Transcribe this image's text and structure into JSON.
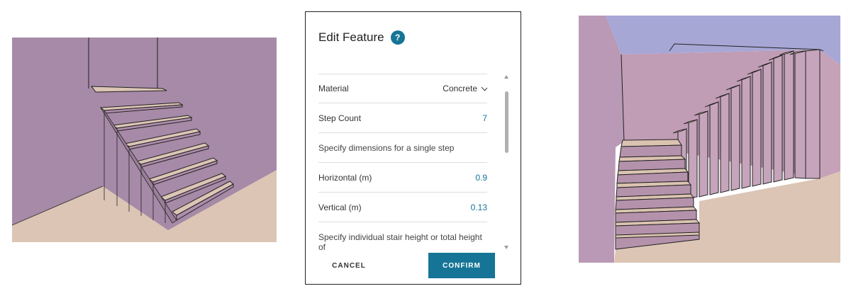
{
  "dialog": {
    "title": "Edit Feature",
    "help_symbol": "?",
    "rows": {
      "material": {
        "label": "Material",
        "value": "Concrete"
      },
      "step_count": {
        "label": "Step Count",
        "value": "7"
      },
      "single_step_note": "Specify dimensions for a single step",
      "horizontal": {
        "label": "Horizontal (m)",
        "value": "0.9"
      },
      "vertical": {
        "label": "Vertical (m)",
        "value": "0.13"
      },
      "height_note": "Specify individual stair height or total height of"
    },
    "buttons": {
      "cancel": "CANCEL",
      "confirm": "CONFIRM"
    },
    "icons": [
      "help-icon",
      "chevron-down-icon",
      "scroll-up-icon",
      "scroll-down-icon"
    ]
  },
  "colors": {
    "accent": "#167596",
    "left_wall": "#a68aa7",
    "floor": "#dcc5b5",
    "right_ceiling": "#a7a7d6",
    "right_wall": "#c09cb5",
    "step_tread": "#dbc3b1"
  }
}
